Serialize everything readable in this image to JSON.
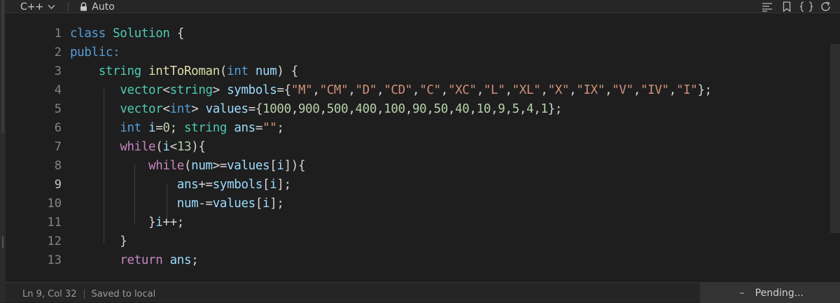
{
  "toolbar": {
    "language": "C++",
    "mode": "Auto"
  },
  "code_lines": [
    {
      "n": "1",
      "text": "class Solution {"
    },
    {
      "n": "2",
      "text": "public:"
    },
    {
      "n": "3",
      "text": "    string intToRoman(int num) {"
    },
    {
      "n": "4",
      "text": "        vector<string> symbols={\"M\",\"CM\",\"D\",\"CD\",\"C\",\"XC\",\"L\",\"XL\",\"X\",\"IX\",\"V\",\"IV\",\"I\"};"
    },
    {
      "n": "5",
      "text": "        vector<int> values={1000,900,500,400,100,90,50,40,10,9,5,4,1};"
    },
    {
      "n": "6",
      "text": "        int i=0; string ans=\"\";"
    },
    {
      "n": "7",
      "text": "        while(i<13){"
    },
    {
      "n": "8",
      "text": "            while(num>=values[i]){"
    },
    {
      "n": "9",
      "text": "                ans+=symbols[i];"
    },
    {
      "n": "10",
      "text": "                num-=values[i];"
    },
    {
      "n": "11",
      "text": "            }i++;"
    },
    {
      "n": "12",
      "text": "        }"
    },
    {
      "n": "13",
      "text": "        return ans;"
    }
  ],
  "status": {
    "cursor": "Ln 9, Col 32",
    "save_state": "Saved to local",
    "pending": "Pending..."
  },
  "colors": {
    "background": "#1e1e1e",
    "keyword": "#569cd6",
    "control": "#c586c0",
    "type": "#4ec9b0",
    "function": "#dcdcaa",
    "variable": "#9cdcfe",
    "string": "#ce9178",
    "number": "#b5cea8"
  }
}
